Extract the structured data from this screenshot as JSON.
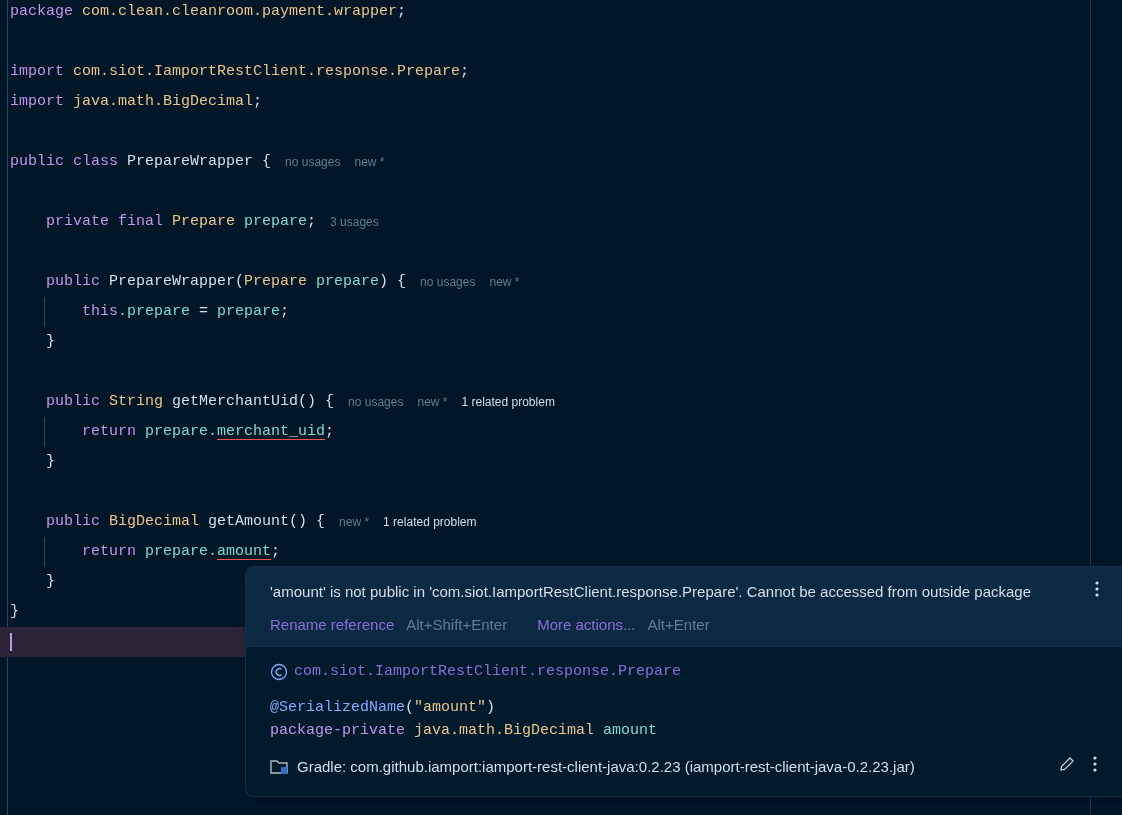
{
  "editor": {
    "lines": [
      {
        "tokens": [
          {
            "t": "package",
            "kind": "keyword"
          },
          {
            "t": " com.clean.cleanroom.payment.wrapper",
            "kind": "type"
          },
          {
            "t": ";",
            "kind": "plain"
          }
        ]
      },
      {
        "kind": "blank"
      },
      {
        "tokens": [
          {
            "t": "import",
            "kind": "keyword"
          },
          {
            "t": " com.siot.IamportRestClient.response.Prepare",
            "kind": "type"
          },
          {
            "t": ";",
            "kind": "plain"
          }
        ]
      },
      {
        "tokens": [
          {
            "t": "import",
            "kind": "keyword"
          },
          {
            "t": " java.math.BigDecimal",
            "kind": "type"
          },
          {
            "t": ";",
            "kind": "plain"
          }
        ]
      },
      {
        "kind": "blank"
      },
      {
        "tokens": [
          {
            "t": "public class",
            "kind": "keyword"
          },
          {
            "t": " PrepareWrapper {",
            "kind": "plain"
          }
        ],
        "hints": [
          {
            "text": "no usages",
            "kind": "hint"
          },
          {
            "text": "new *",
            "kind": "hint"
          }
        ]
      },
      {
        "kind": "blank"
      },
      {
        "tokens": [
          {
            "t": "    private final",
            "kind": "keyword"
          },
          {
            "t": " Prepare",
            "kind": "type"
          },
          {
            "t": " prepare",
            "kind": "field"
          },
          {
            "t": ";",
            "kind": "plain"
          }
        ],
        "hints": [
          {
            "text": "3 usages",
            "kind": "hint"
          }
        ]
      },
      {
        "kind": "blank"
      },
      {
        "tokens": [
          {
            "t": "    public",
            "kind": "keyword"
          },
          {
            "t": " PrepareWrapper(",
            "kind": "plain"
          },
          {
            "t": "Prepare",
            "kind": "type"
          },
          {
            "t": " prepare",
            "kind": "field"
          },
          {
            "t": ") {",
            "kind": "plain"
          }
        ],
        "hints": [
          {
            "text": "no usages",
            "kind": "hint"
          },
          {
            "text": "new *",
            "kind": "hint"
          }
        ]
      },
      {
        "guide": true,
        "tokens": [
          {
            "t": "        this",
            "kind": "keyword"
          },
          {
            "t": ".prepare",
            "kind": "field"
          },
          {
            "t": " = ",
            "kind": "plain"
          },
          {
            "t": "prepare",
            "kind": "field"
          },
          {
            "t": ";",
            "kind": "plain"
          }
        ]
      },
      {
        "tokens": [
          {
            "t": "    }",
            "kind": "plain"
          }
        ]
      },
      {
        "kind": "blank"
      },
      {
        "tokens": [
          {
            "t": "    public",
            "kind": "keyword"
          },
          {
            "t": " String",
            "kind": "type"
          },
          {
            "t": " getMerchantUid() {",
            "kind": "plain"
          }
        ],
        "hints": [
          {
            "text": "no usages",
            "kind": "hint"
          },
          {
            "text": "new *",
            "kind": "hint"
          },
          {
            "text": "1 related problem",
            "kind": "problem"
          }
        ]
      },
      {
        "guide": true,
        "tokens": [
          {
            "t": "        return",
            "kind": "keyword"
          },
          {
            "t": " prepare.",
            "kind": "field"
          },
          {
            "t": "merchant_uid",
            "kind": "error"
          },
          {
            "t": ";",
            "kind": "plain"
          }
        ]
      },
      {
        "tokens": [
          {
            "t": "    }",
            "kind": "plain"
          }
        ]
      },
      {
        "kind": "blank"
      },
      {
        "tokens": [
          {
            "t": "    public",
            "kind": "keyword"
          },
          {
            "t": " BigDecimal",
            "kind": "type"
          },
          {
            "t": " getAmount() {",
            "kind": "plain"
          }
        ],
        "hints": [
          {
            "text": "new *",
            "kind": "hint"
          },
          {
            "text": "1 related problem",
            "kind": "problem"
          }
        ]
      },
      {
        "guide": true,
        "tokens": [
          {
            "t": "        return",
            "kind": "keyword"
          },
          {
            "t": " prepare.",
            "kind": "field"
          },
          {
            "t": "amount",
            "kind": "error"
          },
          {
            "t": ";",
            "kind": "plain"
          }
        ]
      },
      {
        "tokens": [
          {
            "t": "    }",
            "kind": "plain"
          }
        ]
      },
      {
        "tokens": [
          {
            "t": "}",
            "kind": "plain"
          }
        ]
      },
      {
        "kind": "blank",
        "current": true
      }
    ]
  },
  "popup": {
    "message": "'amount' is not public in 'com.siot.IamportRestClient.response.Prepare'. Cannot be accessed from outside package",
    "actions": [
      {
        "label": "Rename reference",
        "shortcut": "Alt+Shift+Enter"
      },
      {
        "label": "More actions...",
        "shortcut": "Alt+Enter"
      }
    ],
    "class_name": "com.siot.IamportRestClient.response.Prepare",
    "declaration": [
      [
        {
          "t": "@SerializedName",
          "kind": "annotation"
        },
        {
          "t": "(",
          "kind": "plain"
        },
        {
          "t": "\"amount\"",
          "kind": "string"
        },
        {
          "t": ")",
          "kind": "plain"
        }
      ],
      [
        {
          "t": "package-private",
          "kind": "keyword"
        },
        {
          "t": " java.math.BigDecimal",
          "kind": "type"
        },
        {
          "t": " amount",
          "kind": "field"
        }
      ]
    ],
    "source": "Gradle: com.github.iamport:iamport-rest-client-java:0.2.23 (iamport-rest-client-java-0.2.23.jar)"
  }
}
